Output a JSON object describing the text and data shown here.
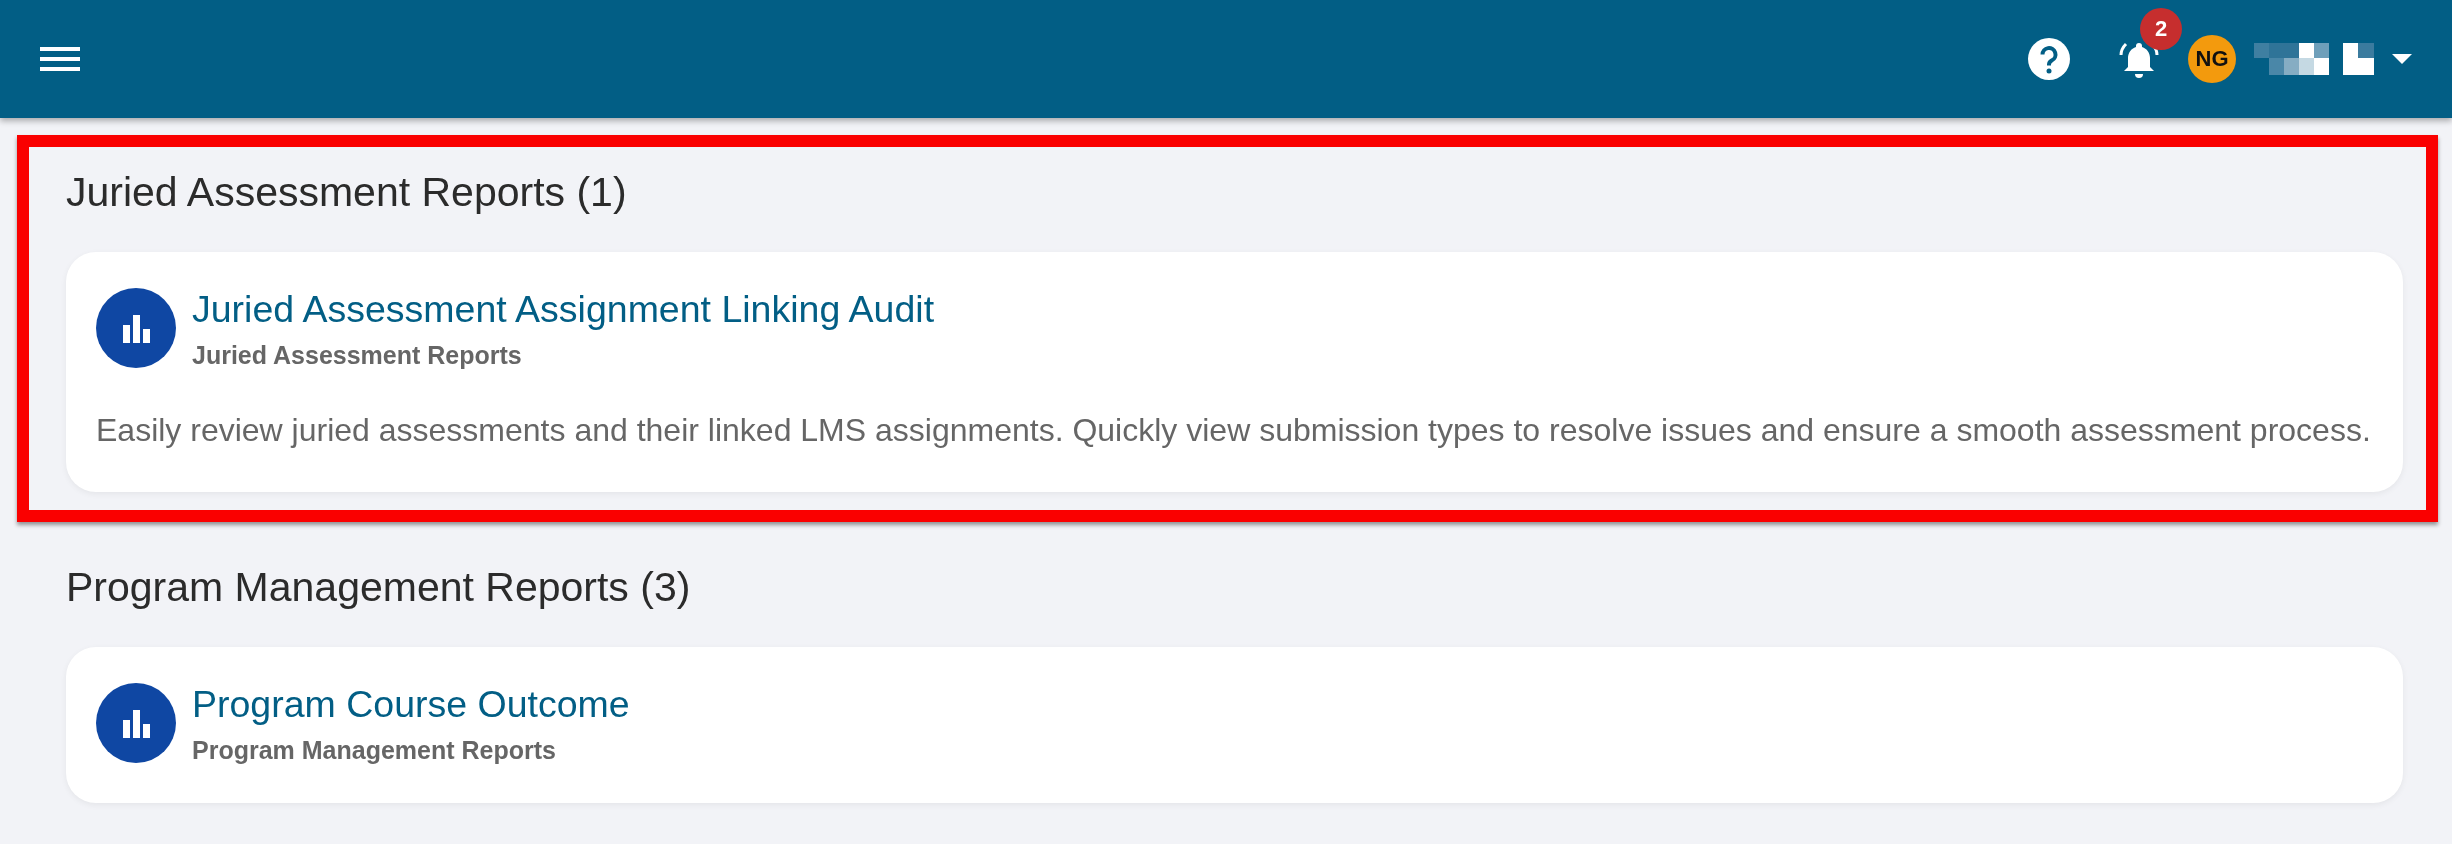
{
  "header": {
    "notification_count": "2",
    "avatar_initials": "NG"
  },
  "sections": [
    {
      "title": "Juried Assessment Reports (1)",
      "highlighted": true,
      "reports": [
        {
          "title": "Juried Assessment Assignment Linking Audit",
          "category": "Juried Assessment Reports",
          "description": "Easily review juried assessments and their linked LMS assignments. Quickly view submission types to resolve issues and ensure a smooth assessment process."
        }
      ]
    },
    {
      "title": "Program Management Reports (3)",
      "highlighted": false,
      "reports": [
        {
          "title": "Program Course Outcome",
          "category": "Program Management Reports"
        }
      ]
    }
  ]
}
